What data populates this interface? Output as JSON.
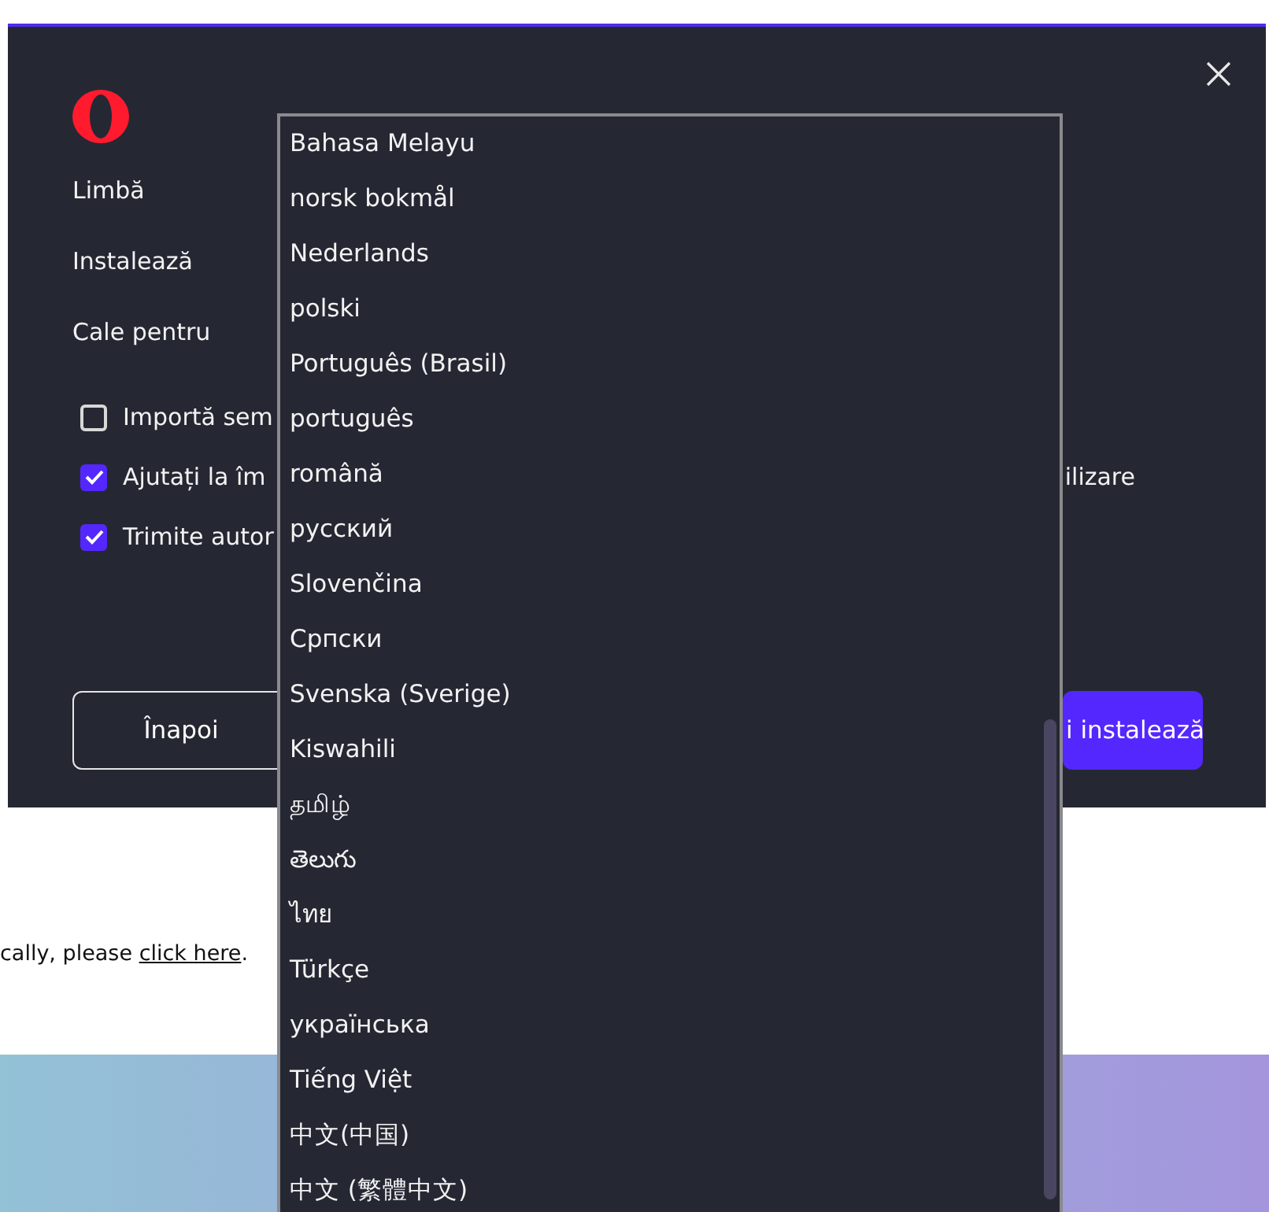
{
  "page": {
    "notice": {
      "text": "cally, please ",
      "link": "click here",
      "end": "."
    }
  },
  "dialog": {
    "fields": [
      {
        "label": "Limbă"
      },
      {
        "label": "Instalează"
      },
      {
        "label": "Cale pentru"
      }
    ],
    "checkboxes": [
      {
        "label": "Importă sem",
        "checked": false
      },
      {
        "label": "Ajutați la îm",
        "label_end": "ilizare",
        "checked": true
      },
      {
        "label": "Trimite autor",
        "checked": true
      }
    ],
    "buttons": [
      {
        "label": "Înapoi",
        "kind": "secondary"
      },
      {
        "label": "i instalează",
        "kind": "primary"
      }
    ]
  },
  "language_dropdown": {
    "options": [
      {
        "label": "Bahasa Melayu",
        "selected": false
      },
      {
        "label": "norsk bokmål",
        "selected": false
      },
      {
        "label": "Nederlands",
        "selected": false
      },
      {
        "label": "polski",
        "selected": false
      },
      {
        "label": "Português (Brasil)",
        "selected": false
      },
      {
        "label": "português",
        "selected": false
      },
      {
        "label": "română",
        "selected": false
      },
      {
        "label": "русский",
        "selected": false
      },
      {
        "label": "Slovenčina",
        "selected": false
      },
      {
        "label": "Српски",
        "selected": false
      },
      {
        "label": "Svenska (Sverige)",
        "selected": false
      },
      {
        "label": "Kiswahili",
        "selected": false
      },
      {
        "label": "தமிழ்",
        "selected": false
      },
      {
        "label": "తెలుగు",
        "selected": false
      },
      {
        "label": "ไทย",
        "selected": false
      },
      {
        "label": "Türkçe",
        "selected": false
      },
      {
        "label": "українська",
        "selected": false
      },
      {
        "label": "Tiếng Việt",
        "selected": false
      },
      {
        "label": "中文(中国)",
        "selected": false
      },
      {
        "label": "中文 (繁體中文)",
        "selected": false
      }
    ]
  }
}
